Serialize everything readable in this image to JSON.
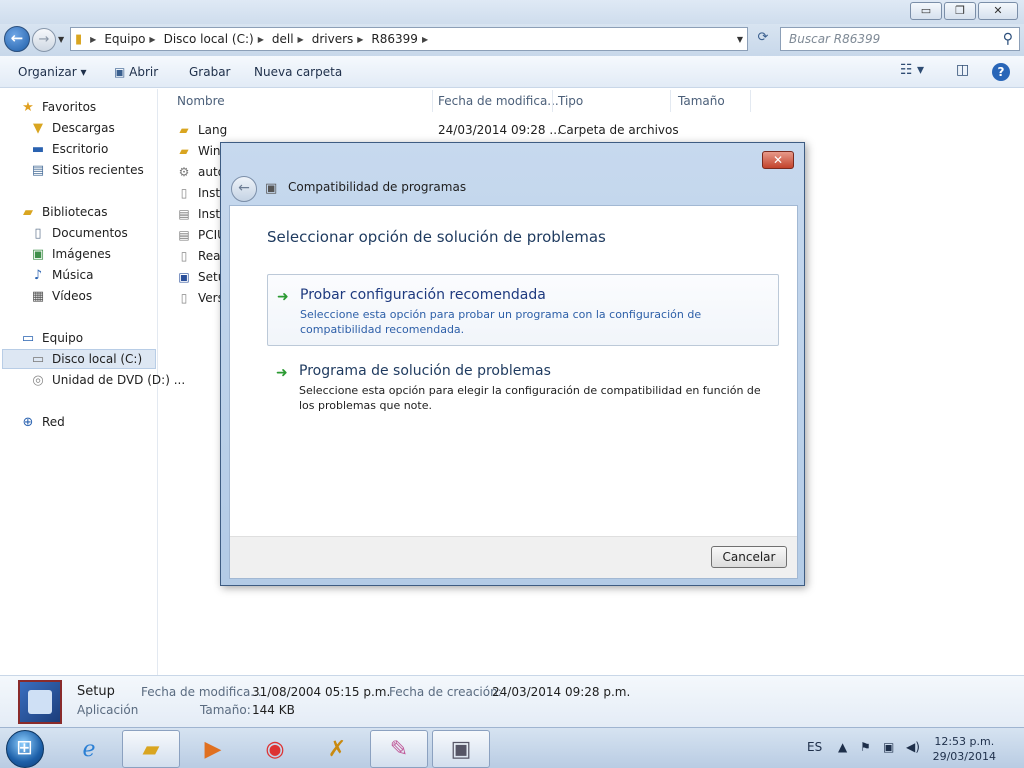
{
  "window": {
    "minimize": "▭",
    "maximize": "❐",
    "close": "✕"
  },
  "address": {
    "crumbs": [
      "Equipo",
      "Disco local (C:)",
      "dell",
      "drivers",
      "R86399"
    ],
    "search_placeholder": "Buscar R86399"
  },
  "toolbar": {
    "organize": "Organizar ▾",
    "open": "Abrir",
    "burn": "Grabar",
    "new_folder": "Nueva carpeta"
  },
  "nav": {
    "favorites": "Favoritos",
    "downloads": "Descargas",
    "desktop": "Escritorio",
    "recent": "Sitios recientes",
    "libraries": "Bibliotecas",
    "documents": "Documentos",
    "pictures": "Imágenes",
    "music": "Música",
    "videos": "Vídeos",
    "computer": "Equipo",
    "local_disk": "Disco local (C:)",
    "dvd": "Unidad de DVD (D:) ...",
    "network": "Red"
  },
  "columns": {
    "name": "Nombre",
    "date": "Fecha de modifica...",
    "type": "Tipo",
    "size": "Tamaño"
  },
  "files": [
    {
      "name": "Lang",
      "date": "24/03/2014 09:28 ...",
      "type": "Carpeta de archivos"
    },
    {
      "name": "Wini",
      "date": "",
      "type": ""
    },
    {
      "name": "auto",
      "date": "",
      "type": ""
    },
    {
      "name": "Insta",
      "date": "",
      "type": ""
    },
    {
      "name": "Instr",
      "date": "",
      "type": ""
    },
    {
      "name": "PCIU",
      "date": "",
      "type": ""
    },
    {
      "name": "Reac",
      "date": "",
      "type": ""
    },
    {
      "name": "Setu",
      "date": "",
      "type": ""
    },
    {
      "name": "Vers",
      "date": "",
      "type": ""
    }
  ],
  "details": {
    "name": "Setup",
    "kind": "Aplicación",
    "modified_label": "Fecha de modifica...",
    "modified_value": "31/08/2004 05:15 p.m.",
    "created_label": "Fecha de creación:",
    "created_value": "24/03/2014 09:28 p.m.",
    "size_label": "Tamaño:",
    "size_value": "144 KB"
  },
  "dialog": {
    "title": "Compatibilidad de programas",
    "heading": "Seleccionar opción de solución de problemas",
    "options": [
      {
        "title": "Probar configuración recomendada",
        "desc": "Seleccione esta opción para probar un programa con la configuración de compatibilidad recomendada."
      },
      {
        "title": "Programa de solución de problemas",
        "desc": "Seleccione esta opción para elegir la configuración de compatibilidad en función de los problemas que note."
      }
    ],
    "cancel": "Cancelar"
  },
  "taskbar": {
    "lang": "ES",
    "time": "12:53 p.m.",
    "date": "29/03/2014"
  },
  "colors": {
    "accent": "#1e3a7f",
    "arrow": "#2b9a32"
  }
}
